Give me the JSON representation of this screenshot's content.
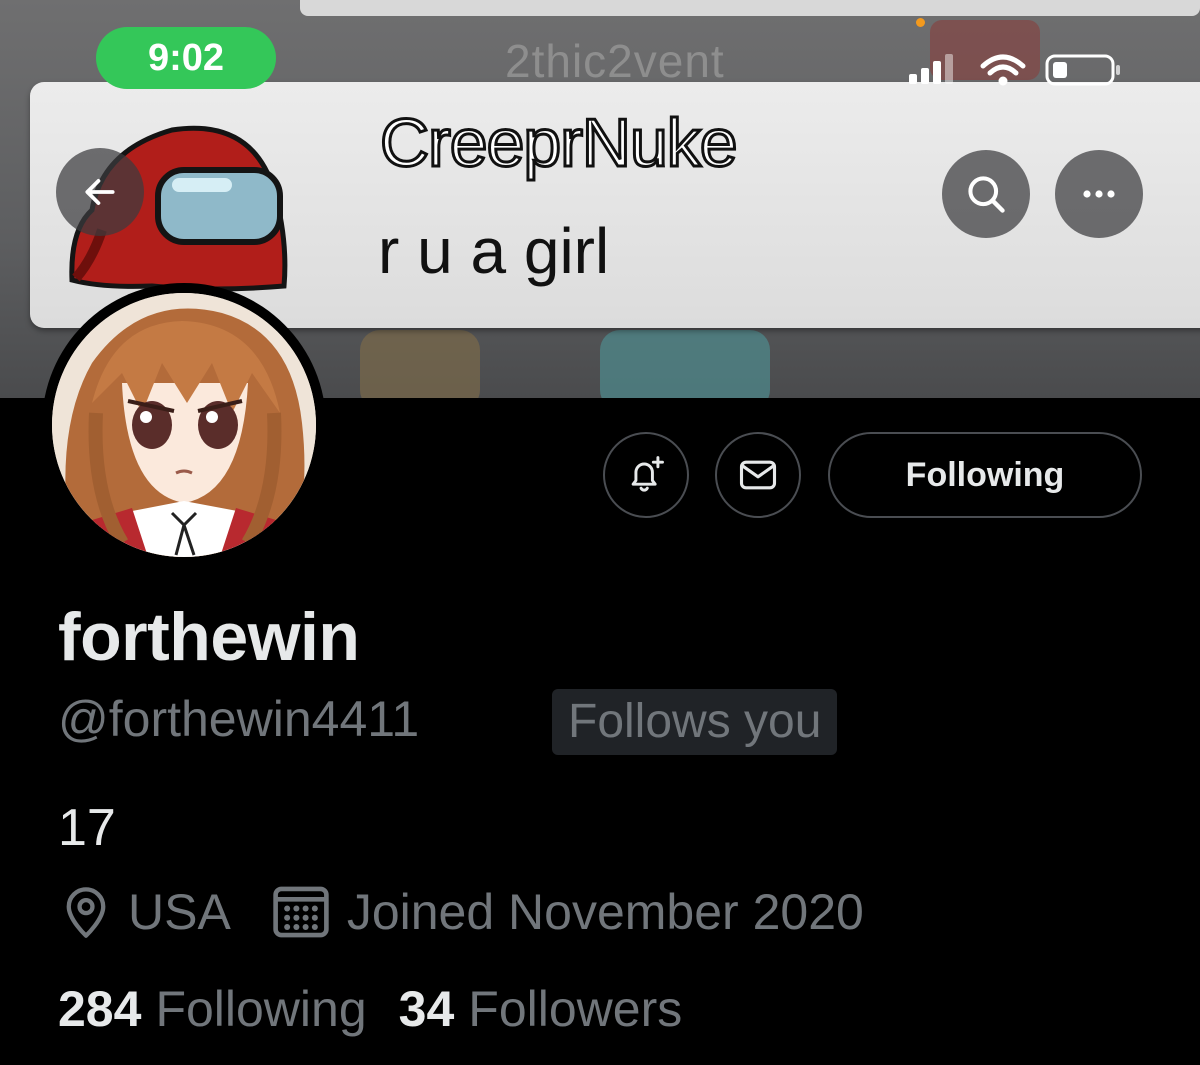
{
  "status_bar": {
    "time": "9:02"
  },
  "banner": {
    "watermark": "2thic2vent",
    "meme_sender": "CreeprNuke",
    "meme_message": "r u a girl"
  },
  "header": {
    "back_icon": "arrow-left-icon",
    "search_icon": "search-icon",
    "more_icon": "more-horizontal-icon"
  },
  "profile": {
    "display_name": "forthewin",
    "handle": "@forthewin4411",
    "follows_you_badge": "Follows you",
    "bio": "17",
    "location": "USA",
    "joined": "Joined November 2020",
    "following_count": "284",
    "following_label": "Following",
    "followers_count": "34",
    "followers_label": "Followers"
  },
  "actions": {
    "notify_icon": "bell-plus-icon",
    "message_icon": "envelope-icon",
    "following_button_label": "Following"
  },
  "colors": {
    "background": "#000000",
    "text_primary": "#e7e9ea",
    "text_secondary": "#71767b",
    "time_pill": "#34c759",
    "border": "#4a4d52"
  }
}
